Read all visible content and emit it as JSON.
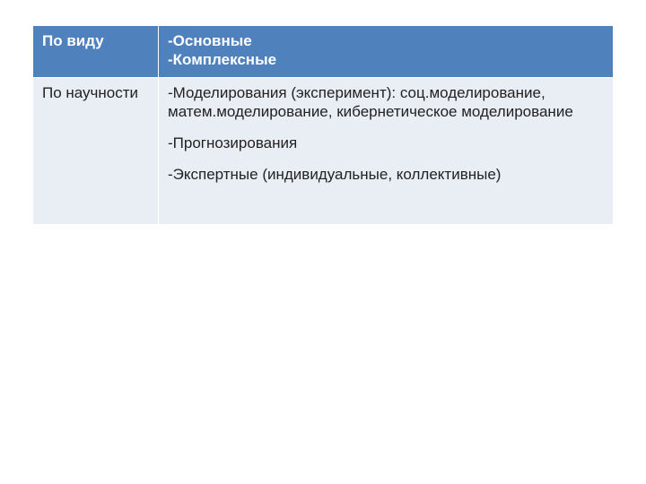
{
  "table": {
    "header": {
      "col1": "По виду",
      "col2_lines": [
        "-Основные",
        "-Комплексные"
      ]
    },
    "row1": {
      "col1": " По научности",
      "col2_blocks": [
        "-Моделирования (эксперимент): соц.моделирование, матем.моделирование, кибернетическое моделирование",
        "-Прогнозирования",
        "-Экспертные (индивидуальные, коллективные)"
      ]
    }
  }
}
